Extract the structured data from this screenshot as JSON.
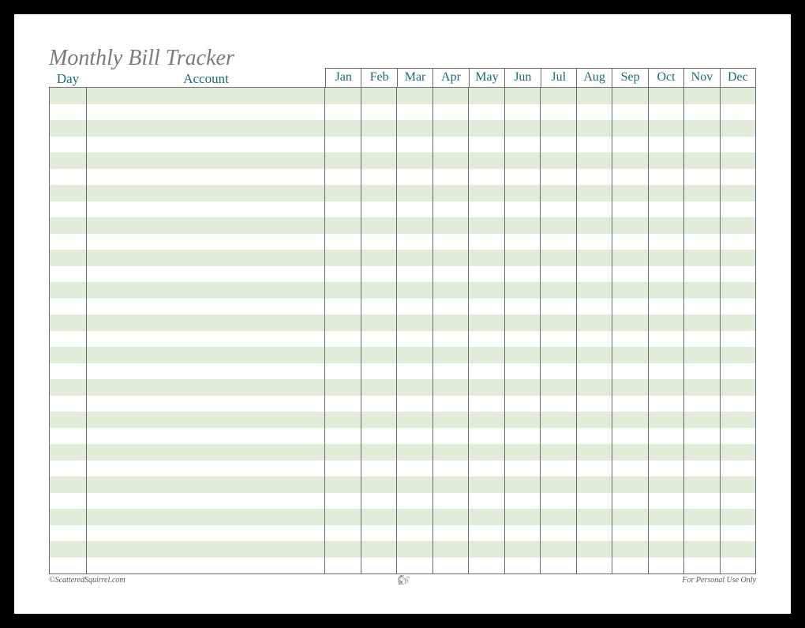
{
  "title": "Monthly Bill Tracker",
  "columns": {
    "day": "Day",
    "account": "Account",
    "months": [
      "Jan",
      "Feb",
      "Mar",
      "Apr",
      "May",
      "Jun",
      "Jul",
      "Aug",
      "Sep",
      "Oct",
      "Nov",
      "Dec"
    ]
  },
  "rows_count": 30,
  "footer": {
    "left": "©ScatteredSquirrel.com",
    "center": "🐿",
    "right": "For Personal Use Only"
  }
}
